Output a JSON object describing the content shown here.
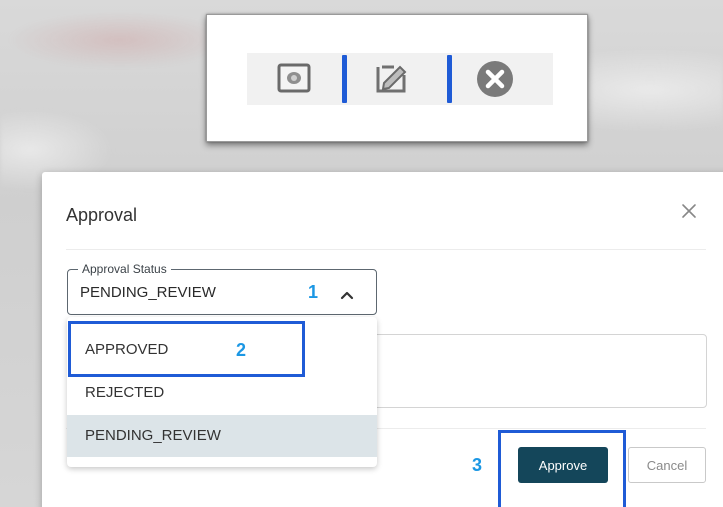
{
  "toolbar": {
    "icons": [
      "view-icon",
      "edit-icon",
      "delete-circle-icon"
    ],
    "colors": {
      "separator": "#1f5bd6"
    }
  },
  "dialog": {
    "title": "Approval",
    "close_icon": "close-icon",
    "approval_status": {
      "label": "Approval Status",
      "value": "PENDING_REVIEW",
      "options": [
        "APPROVED",
        "REJECTED",
        "PENDING_REVIEW"
      ],
      "selected_option": "PENDING_REVIEW"
    },
    "buttons": {
      "approve": "Approve",
      "cancel": "Cancel"
    },
    "colors": {
      "primary": "#14465a",
      "selected_option_bg": "#dce4e8"
    }
  },
  "annotations": {
    "step1": "1",
    "step2": "2",
    "step3": "3",
    "colors": {
      "box": "#1f5bd6",
      "number": "#1b97e4"
    }
  }
}
